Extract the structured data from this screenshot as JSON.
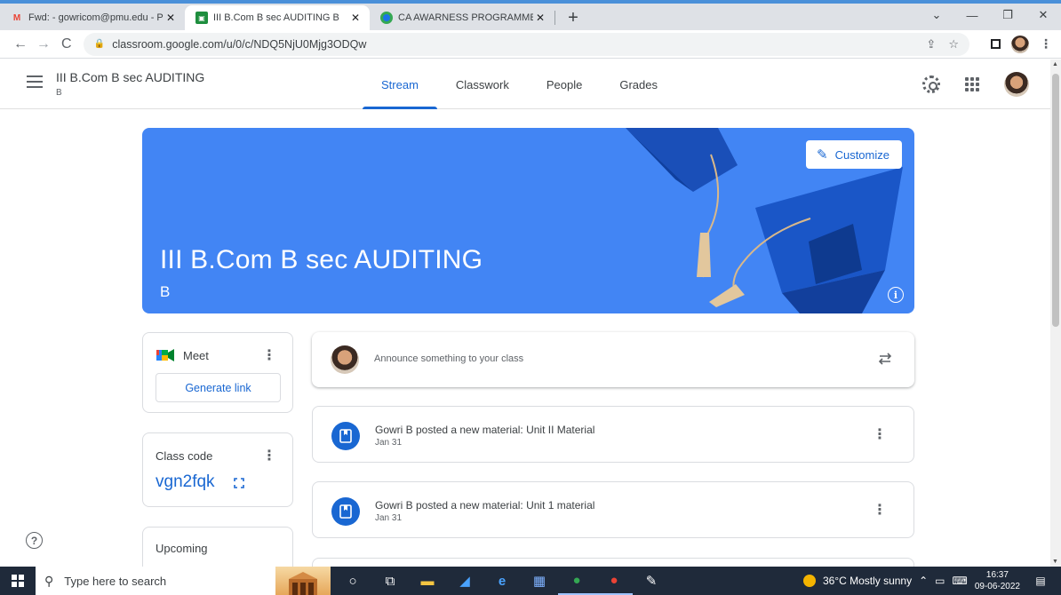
{
  "browser": {
    "tabs": [
      {
        "title": "Fwd: - gowricom@pmu.edu - Pe",
        "favicon": "gmail-icon"
      },
      {
        "title": "III B.Com B sec AUDITING B",
        "favicon": "classroom-icon",
        "active": true
      },
      {
        "title": "CA AWARNESS PROGRAMME - P",
        "favicon": "chrome-icon"
      }
    ],
    "url": "classroom.google.com/u/0/c/NDQ5NjU0Mjg3ODQw"
  },
  "classroom": {
    "course_title": "III B.Com B sec AUDITING",
    "course_section": "B",
    "nav": [
      "Stream",
      "Classwork",
      "People",
      "Grades"
    ],
    "active_nav": "Stream"
  },
  "banner": {
    "title": "III B.Com B sec AUDITING",
    "section": "B",
    "customize_label": "Customize",
    "color": "#4285f4"
  },
  "meet": {
    "label": "Meet",
    "button": "Generate link"
  },
  "class_code": {
    "label": "Class code",
    "value": "vgn2fqk"
  },
  "upcoming": {
    "label": "Upcoming"
  },
  "announce": {
    "placeholder": "Announce something to your class"
  },
  "posts": [
    {
      "title": "Gowri B posted a new material: Unit II Material",
      "date": "Jan 31"
    },
    {
      "title": "Gowri B posted a new material: Unit 1 material",
      "date": "Jan 31"
    }
  ],
  "taskbar": {
    "search_placeholder": "Type here to search",
    "weather": "36°C  Mostly sunny",
    "time": "16:37",
    "date": "09-06-2022"
  },
  "colors": {
    "accent": "#1967d2"
  }
}
